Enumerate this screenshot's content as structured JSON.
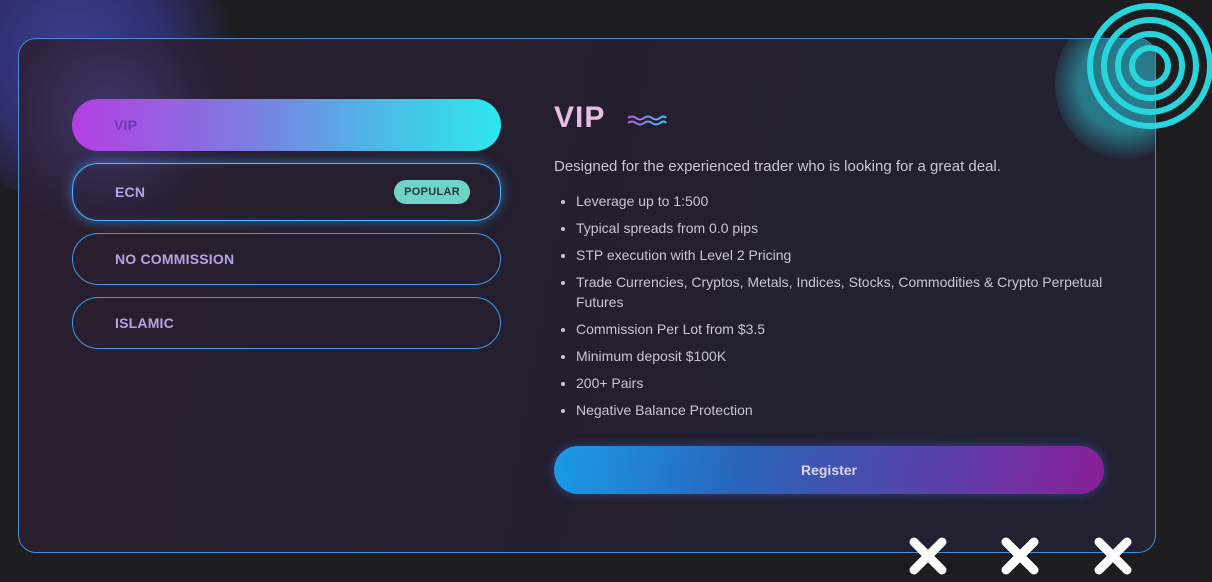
{
  "plans": [
    {
      "label": "VIP"
    },
    {
      "label": "ECN",
      "badge": "POPULAR"
    },
    {
      "label": "NO COMMISSION"
    },
    {
      "label": "ISLAMIC"
    }
  ],
  "details": {
    "title": "VIP",
    "description": "Designed for the experienced trader who is looking for a great deal.",
    "features": [
      "Leverage up to 1:500",
      "Typical spreads from 0.0 pips",
      "STP execution with Level 2 Pricing",
      "Trade Currencies, Cryptos, Metals, Indices, Stocks, Commodities & Crypto Perpetual Futures",
      "Commission Per Lot from $3.5",
      "Minimum deposit $100K",
      "200+ Pairs",
      "Negative Balance Protection"
    ],
    "register_label": "Register"
  },
  "decor": {
    "icons": [
      "spiral-icon",
      "wave-icon",
      "x-mark-icon"
    ],
    "colors": {
      "accent_cyan": "#2ee7ec",
      "accent_magenta": "#b43fe3",
      "border_blue": "#3a9ee8",
      "badge_teal": "#6fd4c6"
    }
  }
}
